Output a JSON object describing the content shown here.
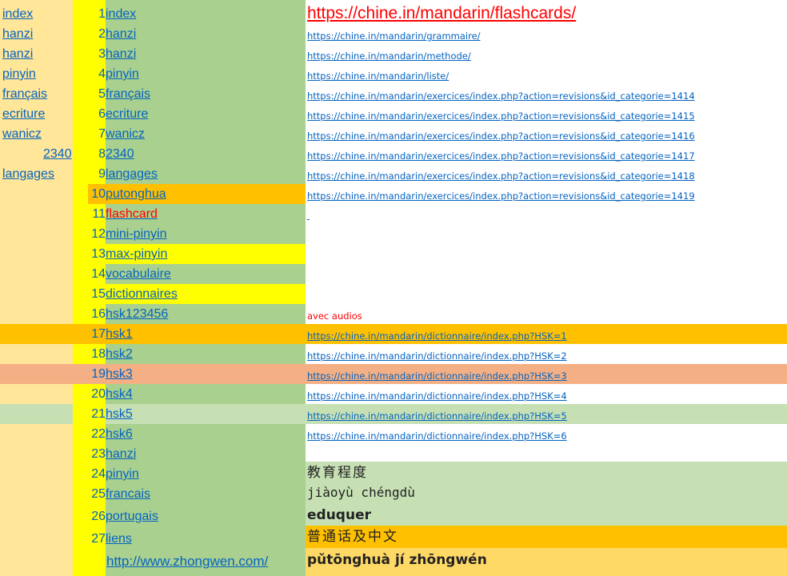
{
  "left_links": [
    "index",
    "hanzi",
    "hanzi",
    "pinyin",
    "français",
    "ecriture",
    "wanicz",
    "2340",
    "langages"
  ],
  "nav_rows": [
    {
      "num": "1",
      "label": "index"
    },
    {
      "num": "2",
      "label": "hanzi"
    },
    {
      "num": "3",
      "label": "hanzi"
    },
    {
      "num": "4",
      "label": "pinyin"
    },
    {
      "num": "5",
      "label": "français"
    },
    {
      "num": "6",
      "label": "ecriture"
    },
    {
      "num": "7",
      "label": "wanicz"
    },
    {
      "num": "8",
      "label": "2340"
    },
    {
      "num": "9",
      "label": "langages"
    },
    {
      "num": "10",
      "label": "putonghua"
    },
    {
      "num": "11",
      "label": "flashcard"
    },
    {
      "num": "12",
      "label": "mini-pinyin"
    },
    {
      "num": "13",
      "label": "max-pinyin"
    },
    {
      "num": "14",
      "label": "vocabulaire"
    },
    {
      "num": "15",
      "label": "dictionnaires"
    },
    {
      "num": "16",
      "label": "hsk123456"
    },
    {
      "num": "17",
      "label": "hsk1"
    },
    {
      "num": "18",
      "label": "hsk2"
    },
    {
      "num": "19",
      "label": "hsk3"
    },
    {
      "num": "20",
      "label": "hsk4"
    },
    {
      "num": "21",
      "label": "hsk5"
    },
    {
      "num": "22",
      "label": "hsk6"
    },
    {
      "num": "23",
      "label": "hanzi"
    },
    {
      "num": "24",
      "label": "pinyin"
    },
    {
      "num": "25",
      "label": "francais"
    },
    {
      "num": "26",
      "label": "portugais"
    },
    {
      "num": "27",
      "label": "liens"
    }
  ],
  "bottom_link": "http://www.zhongwen.com/",
  "header_url": "https://chine.in/mandarin/flashcards/",
  "urls": [
    "https://chine.in/mandarin/grammaire/",
    "https://chine.in/mandarin/methode/",
    "https://chine.in/mandarin/liste/",
    "https://chine.in/mandarin/exercices/index.php?action=revisions&id_categorie=1414",
    "https://chine.in/mandarin/exercices/index.php?action=revisions&id_categorie=1415",
    "https://chine.in/mandarin/exercices/index.php?action=revisions&id_categorie=1416",
    "https://chine.in/mandarin/exercices/index.php?action=revisions&id_categorie=1417",
    "https://chine.in/mandarin/exercices/index.php?action=revisions&id_categorie=1418",
    "https://chine.in/mandarin/exercices/index.php?action=revisions&id_categorie=1419"
  ],
  "audio_note": "avec audios",
  "hsk_urls": [
    "https://chine.in/mandarin/dictionnaire/index.php?HSK=1",
    "https://chine.in/mandarin/dictionnaire/index.php?HSK=2",
    "https://chine.in/mandarin/dictionnaire/index.php?HSK=3",
    "https://chine.in/mandarin/dictionnaire/index.php?HSK=4",
    "https://chine.in/mandarin/dictionnaire/index.php?HSK=5",
    "https://chine.in/mandarin/dictionnaire/index.php?HSK=6"
  ],
  "vocab": {
    "hanzi": "教育程度",
    "pinyin": "jiàoyù chéngdù",
    "french": "eduquer",
    "hanzi2": "普通话及中文",
    "pinyin2": "pǔtōnghuà jí zhōngwén"
  },
  "colors": {
    "orange": "#ffc000",
    "green": "#a9d08e",
    "light_green": "#c6e0b4",
    "salmon": "#f4b084",
    "yellow": "#ffff00",
    "cream": "#ffe699",
    "link": "#0563c1",
    "red": "#ff0000"
  }
}
